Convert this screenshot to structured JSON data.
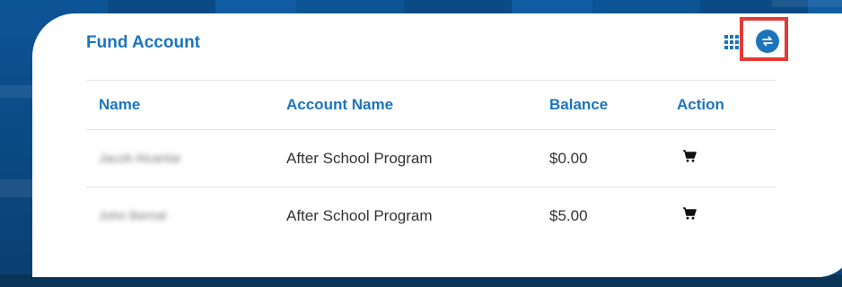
{
  "card": {
    "title": "Fund Account"
  },
  "table": {
    "headers": {
      "name": "Name",
      "account_name": "Account Name",
      "balance": "Balance",
      "action": "Action"
    },
    "rows": [
      {
        "name": "Jacob Alcantar",
        "account_name": "After School Program",
        "balance": "$0.00"
      },
      {
        "name": "John Bernal",
        "account_name": "After School Program",
        "balance": "$5.00"
      }
    ]
  },
  "icons": {
    "grid_view": "grid-icon",
    "swap_view": "swap-arrows-icon",
    "cart": "cart-icon"
  },
  "colors": {
    "accent": "#1c75bc",
    "highlight": "#e53935",
    "text": "#333333",
    "background": "#0f4f8a"
  }
}
